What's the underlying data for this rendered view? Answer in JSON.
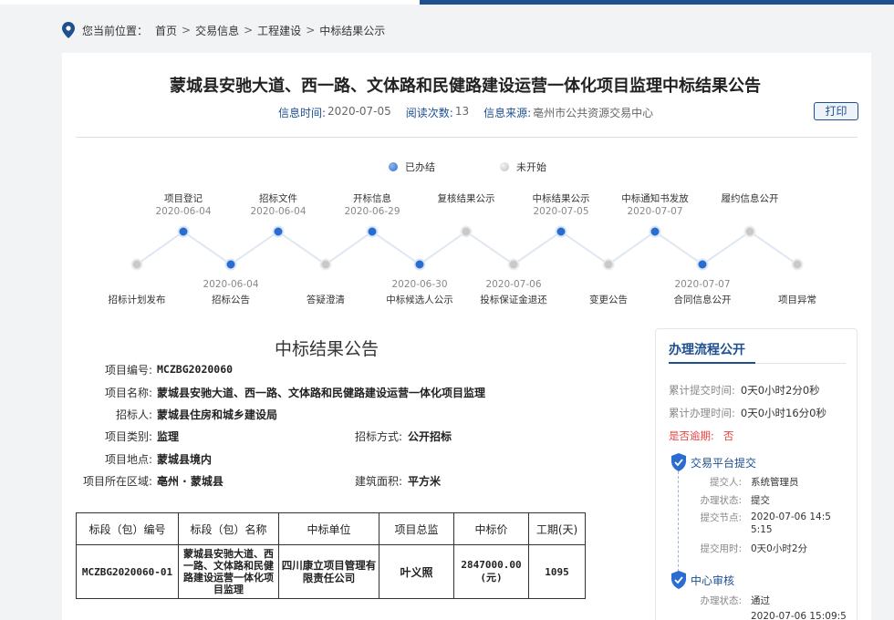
{
  "breadcrumb": {
    "prefix": "您当前位置：",
    "items": [
      "首页",
      "交易信息",
      "工程建设",
      "中标结果公示"
    ]
  },
  "title": "蒙城县安驰大道、西一路、文体路和民健路建设运营一体化项目监理中标结果公告",
  "meta": {
    "info_time_label": "信息时间:",
    "info_time": "2020-07-05",
    "views_label": "阅读次数:",
    "views": "13",
    "source_label": "信息来源:",
    "source": "亳州市公共资源交易中心"
  },
  "print_label": "打印",
  "legend": {
    "done": "已办结",
    "pending": "未开始"
  },
  "flow": {
    "top": [
      {
        "label": "项目登记",
        "date": "2020-06-04",
        "status": "done"
      },
      {
        "label": "招标文件",
        "date": "2020-06-04",
        "status": "done"
      },
      {
        "label": "开标信息",
        "date": "2020-06-29",
        "status": "done"
      },
      {
        "label": "复核结果公示",
        "date": "",
        "status": "pending"
      },
      {
        "label": "中标结果公示",
        "date": "2020-07-05",
        "status": "done"
      },
      {
        "label": "中标通知书发放",
        "date": "2020-07-07",
        "status": "done"
      },
      {
        "label": "履约信息公开",
        "date": "",
        "status": "pending"
      }
    ],
    "bottom": [
      {
        "label": "招标计划发布",
        "date": "",
        "status": "pending"
      },
      {
        "label": "招标公告",
        "date": "2020-06-04",
        "status": "done"
      },
      {
        "label": "答疑澄清",
        "date": "",
        "status": "pending"
      },
      {
        "label": "中标候选人公示",
        "date": "2020-06-30",
        "status": "done"
      },
      {
        "label": "投标保证金退还",
        "date": "2020-07-06",
        "status": "pending"
      },
      {
        "label": "变更公告",
        "date": "",
        "status": "pending"
      },
      {
        "label": "合同信息公开",
        "date": "2020-07-07",
        "status": "done"
      },
      {
        "label": "项目异常",
        "date": "",
        "status": "pending"
      }
    ]
  },
  "notice": {
    "heading": "中标结果公告",
    "project_no_label": "项目编号:",
    "project_no": "MCZBG2020060",
    "project_name_label": "项目名称:",
    "project_name": "蒙城县安驰大道、西一路、文体路和民健路建设运营一体化项目监理",
    "tenderer_label": "招标人:",
    "tenderer": "蒙城县住房和城乡建设局",
    "category_label": "项目类别:",
    "category": "监理",
    "method_label": "招标方式:",
    "method": "公开招标",
    "location_label": "项目地点:",
    "location": "蒙城县境内",
    "region_label": "项目所在区域:",
    "region": "亳州 · 蒙城县",
    "area_label": "建筑面积:",
    "area": "平方米"
  },
  "table": {
    "headers": [
      "标段（包）编号",
      "标段（包）名称",
      "中标单位",
      "项目总监",
      "中标价",
      "工期(天)"
    ],
    "row": {
      "section_no": "MCZBG2020060-01",
      "section_name": "蒙城县安驰大道、西一路、文体路和民健路建设运营一体化项目监理",
      "winner": "四川康立项目管理有限责任公司",
      "director": "叶义照",
      "price": "2847000.00",
      "price_unit": "(元)",
      "duration": "1095"
    }
  },
  "sidebar": {
    "title": "办理流程公开",
    "total_submit_label": "累计提交时间:",
    "total_submit": "0天0小时2分0秒",
    "total_handle_label": "累计办理时间:",
    "total_handle": "0天0小时16分0秒",
    "overdue_label": "是否逾期:",
    "overdue": "否",
    "stage1": {
      "title": "交易平台提交",
      "submitter_label": "提交人:",
      "submitter": "系统管理员",
      "status_label": "办理状态:",
      "status": "提交",
      "node_label": "提交节点:",
      "node": "2020-07-06 14:55:15",
      "used_label": "提交用时:",
      "used": "0天0小时2分"
    },
    "stage2": {
      "title": "中心审核",
      "status_label": "办理状态:",
      "status": "通过",
      "time": "2020-07-06 15:09:5"
    }
  }
}
